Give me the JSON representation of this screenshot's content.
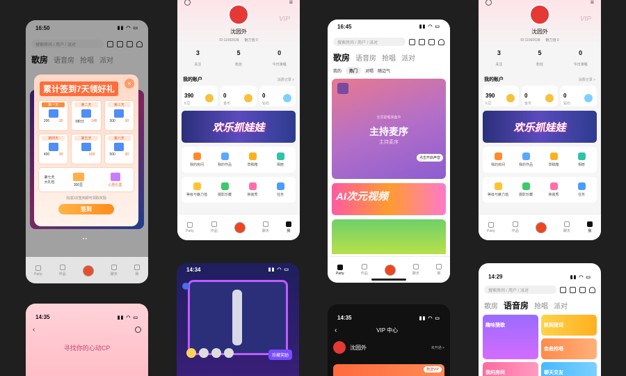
{
  "common": {
    "search_placeholder": "搜索房间 / 用户 / 派对",
    "nav": [
      "Party",
      "作品",
      "",
      "聊天",
      "我"
    ]
  },
  "p1": {
    "time": "16:50",
    "tabs": [
      "歌房",
      "语音房",
      "抢唱",
      "派对"
    ],
    "popup": {
      "title": "累计签到7天领好礼",
      "days": [
        {
          "label": "第一天",
          "a": "200",
          "b": "30"
        },
        {
          "label": "第二天",
          "a": "5积分",
          "b": "145"
        },
        {
          "label": "第三天",
          "a": "300",
          "b": "30"
        },
        {
          "label": "第四天",
          "a": "400",
          "b": "30"
        },
        {
          "label": "第五天",
          "a": "",
          "b": "500"
        },
        {
          "label": "第六天",
          "a": "500",
          "b": "30"
        }
      ],
      "day7": "第七天\n大礼包",
      "day7_a": "300豆",
      "day7_b": "心愿礼盒",
      "hint": "完成3次签到即可领取奖励",
      "button": "签到"
    }
  },
  "p2": {
    "vip": "VIP",
    "name": "沈园外",
    "id": "ID:11992638",
    "charm": "魅力值:0",
    "stats": [
      {
        "v": "3",
        "l": "关注"
      },
      {
        "v": "5",
        "l": "粉丝"
      },
      {
        "v": "0",
        "l": "今日演唱"
      }
    ],
    "account_title": "我的账户",
    "account_link": "消费记录 >",
    "wallet": [
      {
        "v": "390",
        "l": "K豆"
      },
      {
        "v": "0",
        "l": "金币"
      },
      {
        "v": "0",
        "l": "钻石"
      }
    ],
    "banner": "欢乐抓娃娃",
    "grid1": [
      "我的房间",
      "我的作品",
      "草稿箱",
      "相册"
    ],
    "grid2": [
      "等级与魅力值",
      "摄影珍藏",
      "换装秀",
      "任务"
    ]
  },
  "p3": {
    "time": "16:45",
    "tabs": [
      "歌房",
      "语音房",
      "抢唱",
      "派对"
    ],
    "sub": [
      "我的",
      "热门",
      "对唱",
      "随边气"
    ],
    "card_title": "主持麦序",
    "card_sub": "主持麦序",
    "waiting": "全员歌唱准备中",
    "follow_btn": "点击开启声音",
    "ad_text": "AI次元视频"
  },
  "p4": {
    "name": "沈园外",
    "id": "ID:11992638",
    "charm": "魅力值:0",
    "vip": "VIP",
    "stats": [
      {
        "v": "3",
        "l": "关注"
      },
      {
        "v": "5",
        "l": "粉丝"
      },
      {
        "v": "0",
        "l": "今日演唱"
      }
    ],
    "account_title": "我的账户",
    "account_link": "消费记录 >",
    "wallet": [
      {
        "v": "390",
        "l": "K豆"
      },
      {
        "v": "0",
        "l": "金币"
      },
      {
        "v": "0",
        "l": "钻石"
      }
    ],
    "banner": "欢乐抓娃娃",
    "grid1": [
      "我的房间",
      "我的作品",
      "草稿箱",
      "相册"
    ],
    "grid2": [
      "等级与魅力值",
      "摄影珍藏",
      "换装秀",
      "任务"
    ]
  },
  "p5": {
    "time": "14:35",
    "title": "寻找你的心动CP"
  },
  "p6": {
    "time": "14:34",
    "collect": "珍藏奖励"
  },
  "p7": {
    "time": "14:35",
    "title": "VIP 中心",
    "name": "沈园外",
    "status": "未开通 >",
    "gift": "赠送VIP"
  },
  "p8": {
    "time": "14:29",
    "tabs": [
      "歌房",
      "语音房",
      "抢唱",
      "派对"
    ],
    "cards": [
      "趣味猜歌",
      "默契猜词",
      "金曲抢唱",
      "我的房间",
      "聊天交友"
    ]
  }
}
